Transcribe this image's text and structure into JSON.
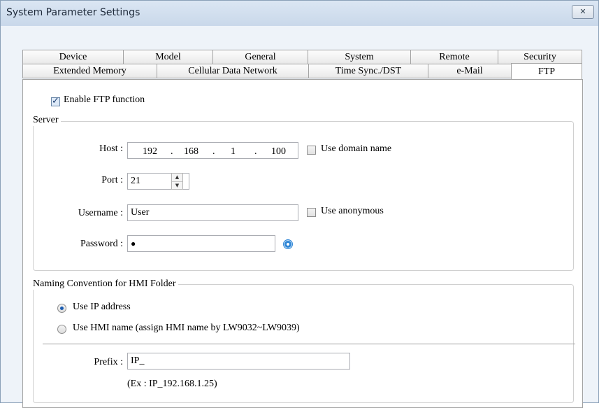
{
  "window": {
    "title": "System Parameter Settings",
    "close_glyph": "✕"
  },
  "tabs_row1": [
    {
      "label": "Device"
    },
    {
      "label": "Model"
    },
    {
      "label": "General"
    },
    {
      "label": "System"
    },
    {
      "label": "Remote"
    },
    {
      "label": "Security"
    }
  ],
  "tabs_row2": [
    {
      "label": "Extended Memory"
    },
    {
      "label": "Cellular Data Network"
    },
    {
      "label": "Time Sync./DST"
    },
    {
      "label": "e-Mail"
    },
    {
      "label": "FTP"
    }
  ],
  "active_tab": "FTP",
  "enable_ftp": {
    "label": "Enable FTP function",
    "checked": true
  },
  "server": {
    "legend": "Server",
    "host_label": "Host :",
    "host_octets": [
      "192",
      "168",
      "1",
      "100"
    ],
    "ip_dot": ".",
    "use_domain_label": "Use domain name",
    "use_domain_checked": false,
    "port_label": "Port :",
    "port_value": "21",
    "username_label": "Username :",
    "username_value": "User",
    "use_anonymous_label": "Use anonymous",
    "use_anonymous_checked": false,
    "password_label": "Password :",
    "password_value": "●",
    "show_password_icon": "eye-icon"
  },
  "naming": {
    "legend": "Naming Convention for HMI Folder",
    "opt_ip_label": "Use IP address",
    "opt_ip_selected": true,
    "opt_name_label": "Use HMI name (assign HMI name by LW9032~LW9039)",
    "opt_name_selected": false,
    "prefix_label": "Prefix :",
    "prefix_value": "IP_",
    "example": "(Ex : IP_192.168.1.25)"
  },
  "colors": {
    "title_bar": "#c9d8ea",
    "radio_dot": "#1b5cb1",
    "eye": "#2f86d6"
  }
}
